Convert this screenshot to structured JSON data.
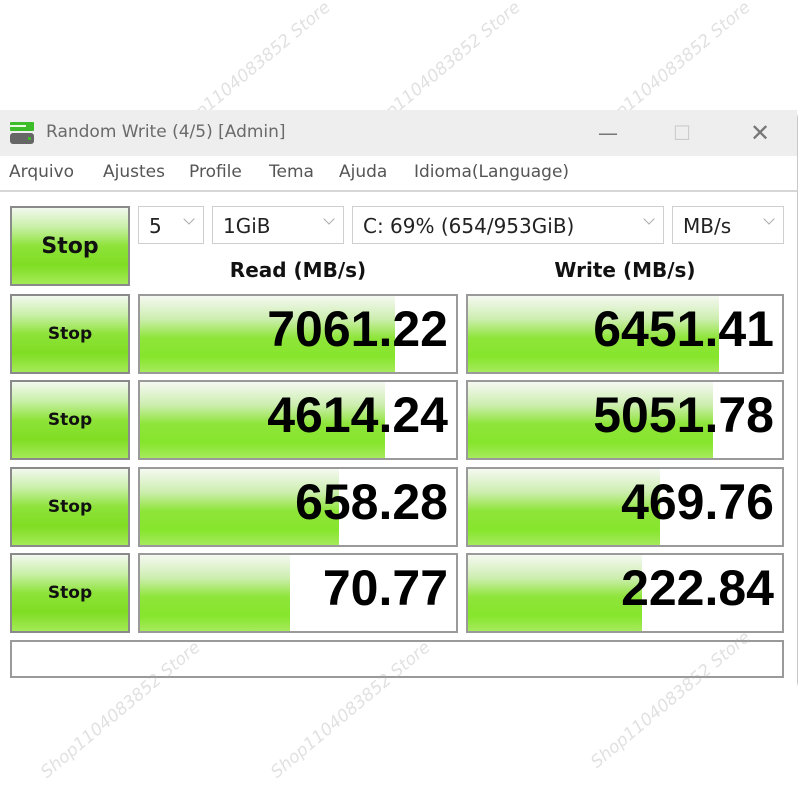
{
  "window": {
    "title": "Random Write (4/5) [Admin]",
    "controls": {
      "minimize": "—",
      "maximize": "☐",
      "close": "✕"
    }
  },
  "menu": [
    "Arquivo",
    "Ajustes",
    "Profile",
    "Tema",
    "Ajuda",
    "Idioma(Language)"
  ],
  "toolbar": {
    "main_button": "Stop",
    "count": "5",
    "size": "1GiB",
    "drive": "C: 69% (654/953GiB)",
    "unit": "MB/s"
  },
  "headers": {
    "read": "Read (MB/s)",
    "write": "Write (MB/s)"
  },
  "rows": [
    {
      "button": "Stop",
      "read": "7061.22",
      "read_fill": 0.806,
      "write": "6451.41",
      "write_fill": 0.8
    },
    {
      "button": "Stop",
      "read": "4614.24",
      "read_fill": 0.775,
      "write": "5051.78",
      "write_fill": 0.78
    },
    {
      "button": "Stop",
      "read": "658.28",
      "read_fill": 0.63,
      "write": "469.76",
      "write_fill": 0.61
    },
    {
      "button": "Stop",
      "read": "70.77",
      "read_fill": 0.475,
      "write": "222.84",
      "write_fill": 0.555
    }
  ],
  "status": "",
  "watermark": "Shop1104083852 Store",
  "colors": {
    "accent_green": "#86e52c",
    "border": "#9a9a9a"
  }
}
